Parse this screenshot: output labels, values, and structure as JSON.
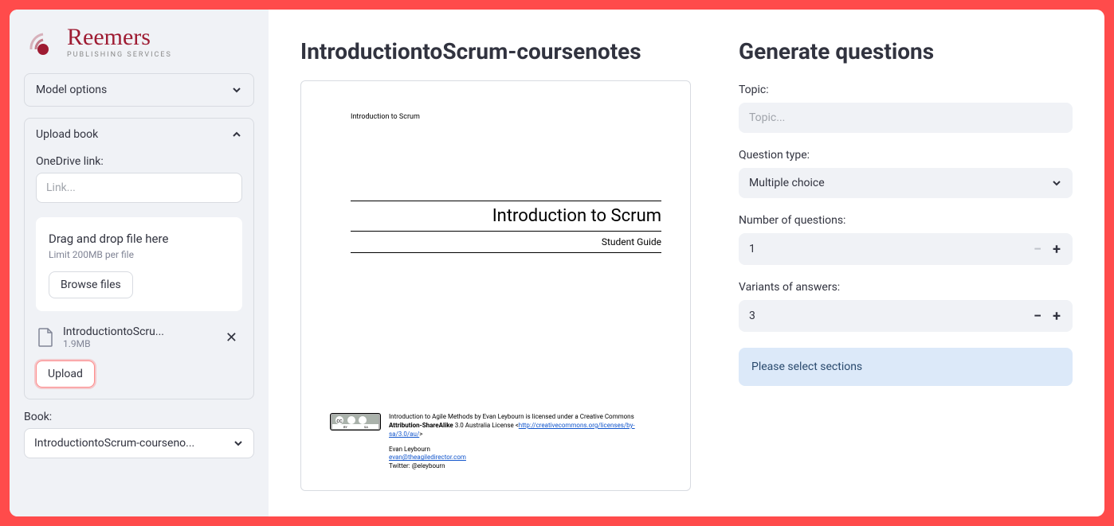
{
  "brand": {
    "name": "Reemers",
    "sub": "PUBLISHING SERVICES"
  },
  "sidebar": {
    "model_options_label": "Model options",
    "upload_book_label": "Upload book",
    "onedrive_label": "OneDrive link:",
    "onedrive_placeholder": "Link...",
    "dropzone_title": "Drag and drop file here",
    "dropzone_sub": "Limit 200MB per file",
    "browse_label": "Browse files",
    "file": {
      "name": "IntroductiontoScru...",
      "size": "1.9MB"
    },
    "upload_btn": "Upload",
    "book_label": "Book:",
    "book_value": "IntroductiontoScrum-courseno..."
  },
  "doc": {
    "filename_heading": "IntroductiontoScrum-coursenotes",
    "pdf_small_header": "Introduction to Scrum",
    "pdf_title": "Introduction to Scrum",
    "pdf_subtitle": "Student Guide",
    "license_text1": "Introduction to Agile Methods by Evan Leybourn is licensed under a Creative Commons ",
    "license_bold": "Attribution-ShareAlike",
    "license_text2": " 3.0 Australia License <",
    "license_link": "http://creativecommons.org/licenses/by-sa/3.0/au/",
    "license_text3": ">",
    "author": "Evan Leybourn",
    "email": "evan@theagiledirector.com",
    "twitter": "Twitter: @eleybourn"
  },
  "form": {
    "heading": "Generate questions",
    "topic_label": "Topic:",
    "topic_placeholder": "Topic...",
    "qtype_label": "Question type:",
    "qtype_value": "Multiple choice",
    "num_label": "Number of questions:",
    "num_value": "1",
    "variants_label": "Variants of answers:",
    "variants_value": "3",
    "info": "Please select sections"
  }
}
